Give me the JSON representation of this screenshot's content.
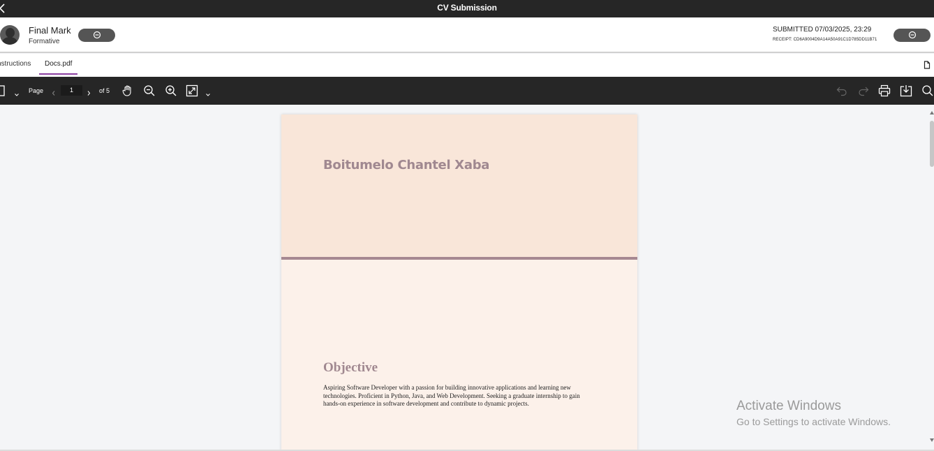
{
  "window": {
    "title": "CV Submission"
  },
  "header": {
    "mark_title": "Final Mark",
    "mark_subtitle": "Formative",
    "submitted": "SUBMITTED 07/03/2025, 23:29",
    "receipt": "RECEIPT: CD6A9004D9A14A50A91C1D785DD11B71"
  },
  "tabs": [
    {
      "label": "nstructions"
    },
    {
      "label": "Docs.pdf",
      "active": true
    }
  ],
  "toolbar": {
    "page_label": "Page",
    "page_value": "1",
    "page_of": "of 5"
  },
  "document": {
    "name": "Boitumelo Chantel Xaba",
    "section_heading": "Objective",
    "objective_text": "Aspiring Software Developer with a passion for building innovative applications and learning new technologies. Proficient in Python, Java, and Web Development. Seeking a graduate internship to gain hands-on experience in software development and contribute to dynamic projects."
  },
  "watermark": {
    "line1": "Activate Windows",
    "line2": "Go to Settings to activate Windows."
  },
  "colors": {
    "accent_tab": "#8a3fa0",
    "pdf_header_bg": "#f9e6d9",
    "pdf_body_bg": "#fcf1ea",
    "pdf_heading": "#a08890",
    "toolbar_bg": "#262626"
  },
  "icons": [
    "back-arrow-icon",
    "minus-circle-icon",
    "file-icon",
    "sidebar-toggle-icon",
    "chevron-down-icon",
    "chevron-left-icon",
    "chevron-right-icon",
    "hand-pan-icon",
    "zoom-out-icon",
    "zoom-in-icon",
    "fit-page-icon",
    "undo-icon",
    "redo-icon",
    "print-icon",
    "download-icon",
    "search-icon"
  ]
}
